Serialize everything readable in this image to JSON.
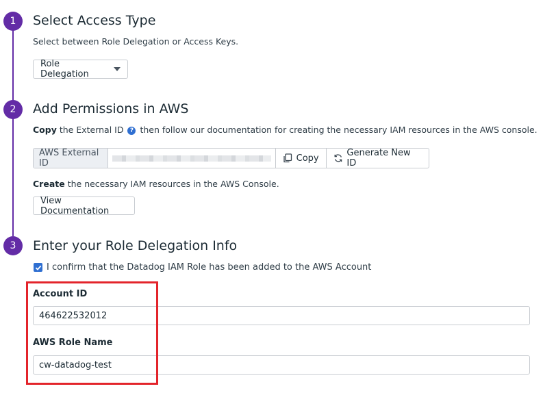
{
  "steps": [
    {
      "number": "1",
      "title": "Select Access Type",
      "description": "Select between Role Delegation or Access Keys.",
      "dropdown": {
        "selected": "Role Delegation"
      }
    },
    {
      "number": "2",
      "title": "Add Permissions in AWS",
      "copy_bold": "Copy",
      "copy_text_1": "the External ID",
      "copy_text_2": "then follow our documentation for creating the necessary IAM resources in the AWS console.",
      "external_id": {
        "label": "AWS External ID",
        "copy_label": "Copy",
        "generate_label": "Generate New ID"
      },
      "create_bold": "Create",
      "create_text": "the necessary IAM resources in the AWS Console.",
      "doc_button": "View Documentation"
    },
    {
      "number": "3",
      "title": "Enter your Role Delegation Info",
      "confirm_label": "I confirm that the Datadog IAM Role has been added to the AWS Account",
      "confirm_checked": true,
      "account_id": {
        "label": "Account ID",
        "value": "464622532012"
      },
      "role_name": {
        "label": "AWS Role Name",
        "value": "cw-datadog-test"
      }
    }
  ],
  "colors": {
    "step_accent": "#632ca6",
    "checkbox": "#2f6fd1",
    "highlight": "#e3242b"
  },
  "icons": [
    "help-icon",
    "copy-icon",
    "refresh-icon",
    "chevron-down-icon",
    "checkmark-icon"
  ]
}
